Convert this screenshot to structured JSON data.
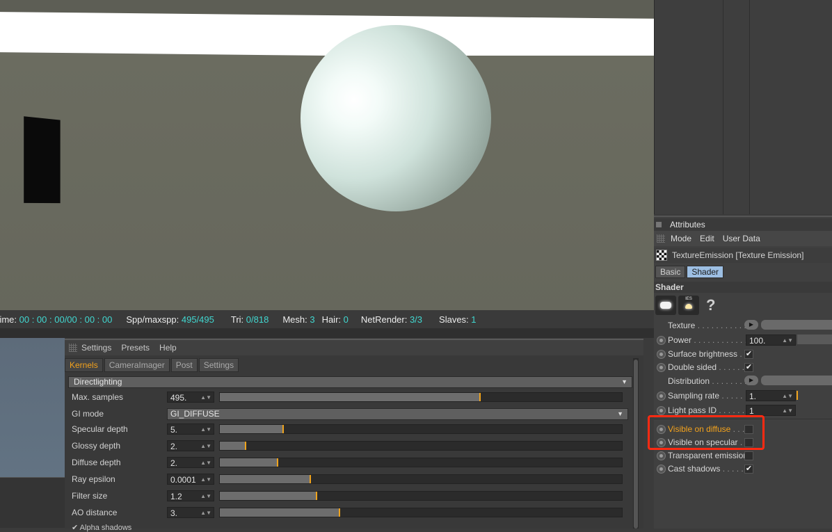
{
  "status": {
    "time_label": "Time: ",
    "time_value": "00 : 00 : 00/00 : 00 : 00",
    "spp_label": "Spp/maxspp: ",
    "spp_value": "495/495",
    "tri_label": "Tri: ",
    "tri_value": "0/818",
    "mesh_label": "Mesh: ",
    "mesh_value": "3",
    "hair_label": "Hair: ",
    "hair_value": "0",
    "netrender_label": "NetRender: ",
    "netrender_value": "3/3",
    "slaves_label": "Slaves: ",
    "slaves_value": "1"
  },
  "settings": {
    "menu": [
      "Settings",
      "Presets",
      "Help"
    ],
    "tabs": [
      "Kernels",
      "CameraImager",
      "Post",
      "Settings"
    ],
    "kernel": "Directlighting",
    "gi_mode_label": "GI mode",
    "gi_mode_value": "GI_DIFFUSE",
    "rows": [
      {
        "label": "Max. samples",
        "value": "495.",
        "fraction": 0.645
      },
      {
        "label": "Specular depth",
        "value": "5.",
        "fraction": 0.155
      },
      {
        "label": "Glossy depth",
        "value": "2.",
        "fraction": 0.062
      },
      {
        "label": "Diffuse depth",
        "value": "2.",
        "fraction": 0.142
      },
      {
        "label": "Ray epsilon",
        "value": "0.0001",
        "fraction": 0.223
      },
      {
        "label": "Filter size",
        "value": "1.2",
        "fraction": 0.238
      },
      {
        "label": "AO distance",
        "value": "3.",
        "fraction": 0.296
      }
    ],
    "alpha_shadows": "Alpha shadows"
  },
  "attributes": {
    "title": "Attributes",
    "menu": [
      "Mode",
      "Edit",
      "User Data"
    ],
    "object": "TextureEmission [Texture Emission]",
    "tabs": [
      "Basic",
      "Shader"
    ],
    "section": "Shader",
    "help_glyph": "?",
    "ies_label": "IES",
    "params": {
      "texture": "Texture",
      "power": "Power",
      "power_value": "100.",
      "surface_brightness": "Surface brightness",
      "double_sided": "Double sided",
      "distribution": "Distribution",
      "sampling_rate": "Sampling rate",
      "sampling_rate_value": "1.",
      "light_pass_id": "Light pass ID",
      "light_pass_id_value": "1",
      "visible_on_diffuse": "Visible on diffuse",
      "visible_on_specular": "Visible on specular",
      "transparent_emission": "Transparent emission",
      "cast_shadows": "Cast shadows"
    }
  },
  "colors": {
    "accent": "#f3a21c",
    "status_value": "#41d7d0",
    "highlight": "#ff2a12",
    "active_tab": "#9dbfe3"
  }
}
